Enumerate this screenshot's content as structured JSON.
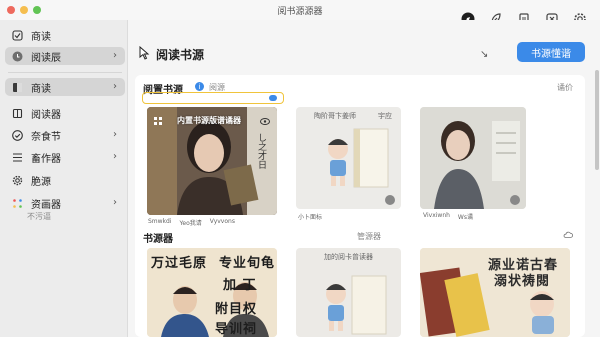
{
  "window": {
    "title": "阅书源源器"
  },
  "toolbar": {
    "icons": [
      "compass-icon",
      "leaf-icon",
      "document-icon",
      "close-box-icon",
      "gear-icon"
    ]
  },
  "sidebar": {
    "items": [
      {
        "label": "商读",
        "icon": "checkbox-icon"
      },
      {
        "label": "阅读辰",
        "icon": "clock-icon"
      },
      {
        "label": "商读",
        "icon": "book-split-icon"
      },
      {
        "label": "阅读器",
        "icon": "book-icon"
      },
      {
        "label": "奈食节",
        "icon": "check-circle-icon"
      },
      {
        "label": "畜作器",
        "icon": "list-icon"
      },
      {
        "label": "脃源",
        "icon": "gear-icon"
      },
      {
        "label": "资画器",
        "icon": "grid-dots-icon",
        "sub": "不污逼"
      }
    ]
  },
  "header": {
    "title": "阅读书源",
    "sort_glyph": "↘",
    "primary_button": "书源懂谐"
  },
  "section1": {
    "title": "阅置书源",
    "sub": "阅源",
    "right": "谲价",
    "cards": [
      {
        "overlay_title": "内置书源版谱谲器",
        "side_text": "し之才日",
        "foot": [
          "Smwkdi",
          "Yeo我请",
          "Vyvvons"
        ]
      },
      {
        "caption": "陶阶哥卞姜师",
        "caption2": "宇应",
        "foot": [
          "小卜面标"
        ]
      },
      {
        "foot": [
          "Vivxiwnh",
          "Ws谲"
        ]
      }
    ]
  },
  "section2": {
    "title": "书源器",
    "right": "管源器",
    "cards": [
      {
        "lines": [
          "万过毛原",
          "专业旬龟",
          "加 丁",
          "附目权",
          "导训祠"
        ]
      },
      {
        "caption": "加的阅卡曾读器"
      },
      {
        "lines": [
          "源业诺古春",
          "溺状祷閱"
        ]
      }
    ]
  }
}
